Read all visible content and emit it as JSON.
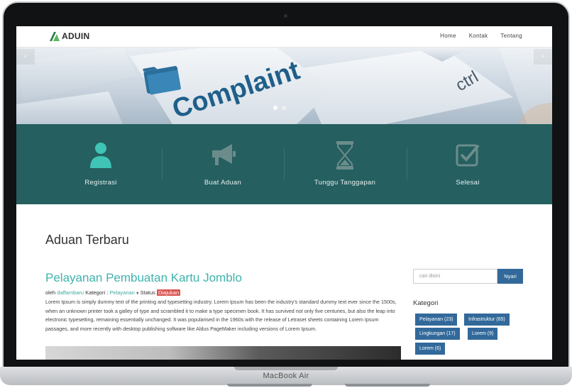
{
  "device": {
    "label": "MacBook Air"
  },
  "navbar": {
    "brand": "ADUIN",
    "links": [
      "Home",
      "Kontak",
      "Tentang"
    ]
  },
  "hero": {
    "prev": "‹",
    "next": "›",
    "keyboard_words": [
      "Complaint",
      "ctrl"
    ]
  },
  "steps": [
    {
      "label": "Registrasi",
      "icon": "user-icon"
    },
    {
      "label": "Buat Aduan",
      "icon": "megaphone-icon"
    },
    {
      "label": "Tunggu Tanggapan",
      "icon": "hourglass-icon"
    },
    {
      "label": "Selesai",
      "icon": "check-square-icon"
    }
  ],
  "main": {
    "section_title": "Aduan Terbaru",
    "post": {
      "title": "Pelayanan Pembuatan Kartu Jomblo",
      "meta_by": "oleh",
      "author": "daffambaru",
      "meta_category": "Kategori :",
      "category": "Pelayanan",
      "meta_status": "Status",
      "status": "Diajukan",
      "body": "Lorem Ipsum is simply dummy text of the printing and typesetting industry. Lorem Ipsum has been the industry's standard dummy text ever since the 1500s, when an unknown printer took a galley of type and scrambled it to make a type specimen book. It has survived not only five centuries, but also the leap into electronic typesetting, remaining essentially unchanged. It was popularised in the 1960s with the release of Letraset sheets containing Lorem Ipsum passages, and more recently with desktop publishing software like Aldus PageMaker including versions of Lorem Ipsum."
    }
  },
  "sidebar": {
    "search_placeholder": "cari disini",
    "search_button": "Nyari",
    "categories_title": "Kategori",
    "categories": [
      "Pelayanan (23)",
      "Infrastruktur (65)",
      "Lingkungan (17)",
      "Lorem (9)",
      "Lorem (6)"
    ]
  },
  "colors": {
    "teal_band": "#255f60",
    "accent_teal": "#3fb3ad",
    "button_blue": "#32699a",
    "status_red": "#d9534f"
  }
}
